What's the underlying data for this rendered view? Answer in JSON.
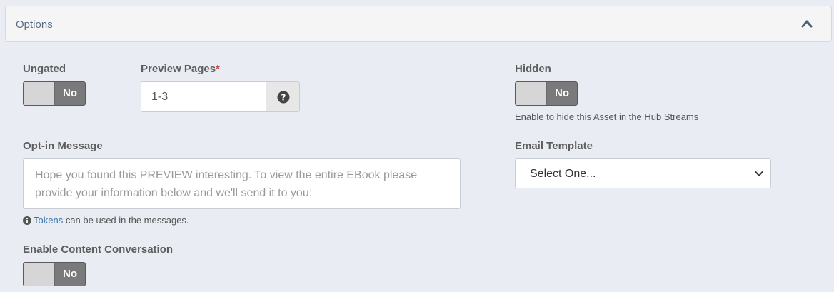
{
  "panel": {
    "title": "Options",
    "toggle_icon": "chevron-up-icon"
  },
  "ungated": {
    "label": "Ungated",
    "state": "No"
  },
  "preview_pages": {
    "label": "Preview Pages",
    "required_mark": "*",
    "value": "1-3",
    "help_icon": "question-circle-icon"
  },
  "hidden": {
    "label": "Hidden",
    "state": "No",
    "help": "Enable to hide this Asset in the Hub Streams"
  },
  "opt_in": {
    "label": "Opt-in Message",
    "placeholder": "Hope you found this PREVIEW interesting. To view the entire EBook please provide your information below and we'll send it to you:"
  },
  "email_template": {
    "label": "Email Template",
    "selected": "Select One..."
  },
  "tokens_note": {
    "icon": "info-circle-icon",
    "link": "Tokens",
    "text": " can be used in the messages."
  },
  "content_conversation": {
    "label": "Enable Content Conversation",
    "state": "No"
  }
}
